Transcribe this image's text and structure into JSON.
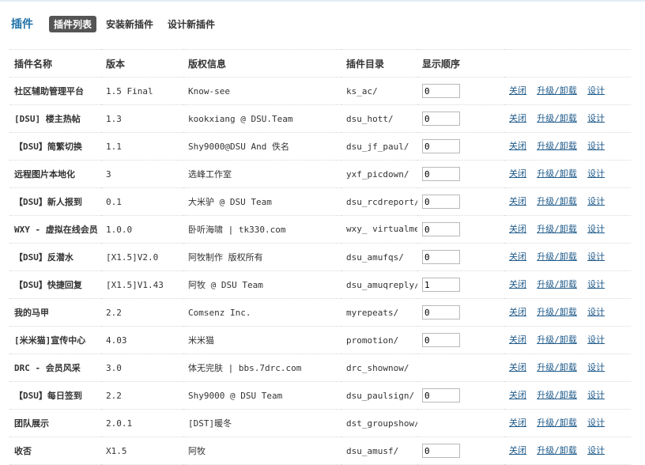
{
  "header": {
    "title": "插件",
    "tabs": [
      "插件列表",
      "安装新插件",
      "设计新插件"
    ]
  },
  "table": {
    "columns": [
      "插件名称",
      "版本",
      "版权信息",
      "插件目录",
      "显示顺序"
    ],
    "actions": {
      "close": "关闭",
      "upgrade": "升级/卸载",
      "design": "设计"
    },
    "rows": [
      {
        "name": "社区辅助管理平台",
        "version": "1.5 Final",
        "copyright": "Know-see",
        "dir": "ks_ac/",
        "order": "0"
      },
      {
        "name": "[DSU] 楼主热帖",
        "version": "1.3",
        "copyright": "kookxiang @ DSU.Team",
        "dir": "dsu_hott/",
        "order": "0"
      },
      {
        "name": "【DSU】简繁切换",
        "version": "1.1",
        "copyright": "Shy9000@DSU And 佚名",
        "dir": "dsu_jf_paul/",
        "order": "0"
      },
      {
        "name": "远程图片本地化",
        "version": "3",
        "copyright": "选峰工作室",
        "dir": "yxf_picdown/",
        "order": "0"
      },
      {
        "name": "【DSU】新人报到",
        "version": "0.1",
        "copyright": "大米驴 @ DSU Team",
        "dir": "dsu_rcdreport/",
        "order": "0"
      },
      {
        "name": "WXY - 虚拟在线会员",
        "version": "1.0.0",
        "copyright": "卧听海啸 | tk330.com",
        "dir": "wxy_ virtualmember/",
        "order": "0"
      },
      {
        "name": "【DSU】反潜水",
        "version": "[X1.5]V2.0",
        "copyright": "阿牧制作 版权所有",
        "dir": "dsu_amufqs/",
        "order": "0"
      },
      {
        "name": "【DSU】快捷回复",
        "version": "[X1.5]V1.43",
        "copyright": "阿牧 @ DSU Team",
        "dir": "dsu_amuqreply/",
        "order": "1"
      },
      {
        "name": "我的马甲",
        "version": "2.2",
        "copyright": "Comsenz Inc.",
        "dir": "myrepeats/",
        "order": "0"
      },
      {
        "name": "[米米猫]宣传中心",
        "version": "4.03",
        "copyright": "米米猫",
        "dir": "promotion/",
        "order": "0"
      },
      {
        "name": "DRC - 会员风采",
        "version": "3.0",
        "copyright": "体无完肤 | bbs.7drc.com",
        "dir": "drc_shownow/",
        "order": null
      },
      {
        "name": "【DSU】每日签到",
        "version": "2.2",
        "copyright": "Shy9000 @ DSU Team",
        "dir": "dsu_paulsign/",
        "order": "0"
      },
      {
        "name": "团队展示",
        "version": "2.0.1",
        "copyright": "[DST]暖冬",
        "dir": "dst_groupshow/",
        "order": null
      },
      {
        "name": "收否",
        "version": "X1.5",
        "copyright": "阿牧",
        "dir": "dsu_amusf/",
        "order": "0"
      }
    ]
  }
}
